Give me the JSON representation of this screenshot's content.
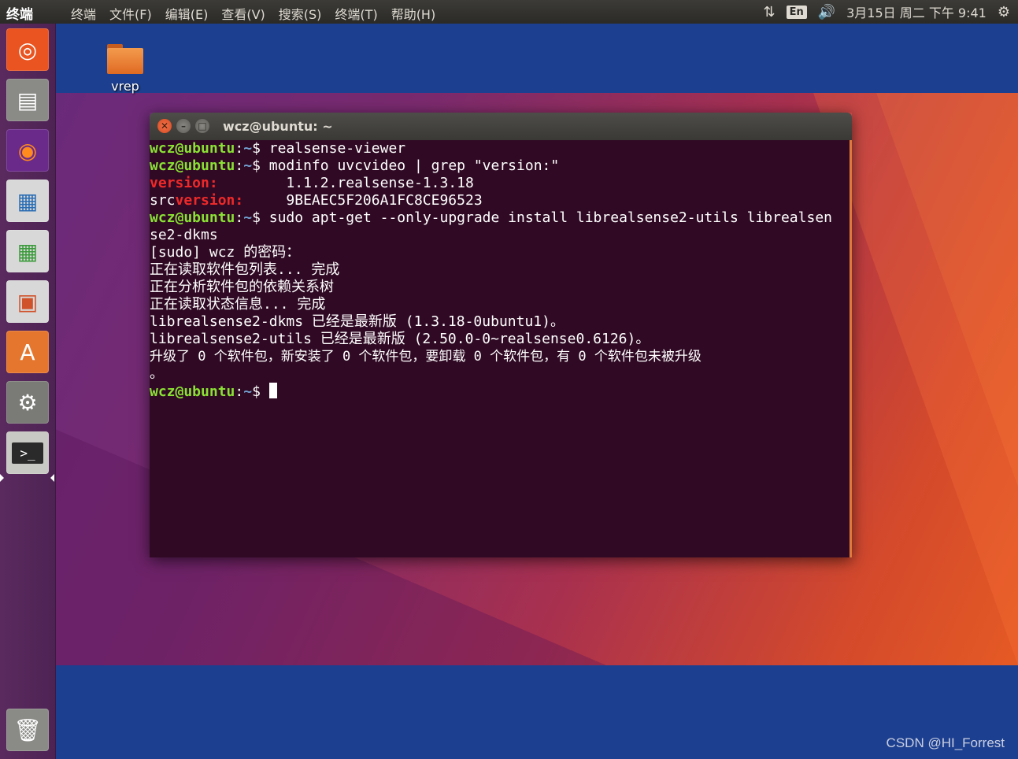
{
  "top_panel": {
    "app_title": "终端",
    "menu": [
      "终端",
      "文件(F)",
      "编辑(E)",
      "查看(V)",
      "搜索(S)",
      "终端(T)",
      "帮助(H)"
    ],
    "keyboard_lang": "En",
    "datetime": "3月15日 周二 下午 9:41"
  },
  "launcher": {
    "items": [
      {
        "name": "ubuntu-dash-icon",
        "glyph": "◎",
        "bg": "#e95420"
      },
      {
        "name": "files-icon",
        "glyph": "▤",
        "bg": "#7a7a7a"
      },
      {
        "name": "firefox-icon",
        "glyph": "◉",
        "bg": "#e66000"
      },
      {
        "name": "libreoffice-writer-icon",
        "glyph": "▦",
        "bg": "#2a6db3"
      },
      {
        "name": "libreoffice-calc-icon",
        "glyph": "▦",
        "bg": "#3c9a3c"
      },
      {
        "name": "libreoffice-impress-icon",
        "glyph": "▣",
        "bg": "#d0522a"
      },
      {
        "name": "software-center-icon",
        "glyph": "A",
        "bg": "#e5762e"
      },
      {
        "name": "system-settings-icon",
        "glyph": "⚙",
        "bg": "#6a6a6a"
      },
      {
        "name": "terminal-icon",
        "glyph": ">_",
        "bg": "#3a3a3a"
      },
      {
        "name": "trash-icon",
        "glyph": "🗑",
        "bg": "#8a8a8a"
      }
    ]
  },
  "desktop": {
    "folder_label": "vrep"
  },
  "terminal": {
    "title": "wcz@ubuntu: ~",
    "user": "wcz@ubuntu",
    "path": "~",
    "lines": {
      "cmd1": "realsense-viewer",
      "cmd2": "modinfo uvcvideo | grep \"version:\"",
      "version_key": "version:",
      "version_val": "        1.1.2.realsense-1.3.18",
      "srcversion_prefix": "src",
      "srcversion_key": "version:",
      "srcversion_val": "     9BEAEC5F206A1FC8CE96523",
      "cmd3": "sudo apt-get --only-upgrade install librealsense2-utils librealsen",
      "cmd3_wrap": "se2-dkms",
      "out1": "[sudo] wcz 的密码：",
      "out2": "正在读取软件包列表... 完成",
      "out3": "正在分析软件包的依赖关系树",
      "out4": "正在读取状态信息... 完成",
      "out5": "librealsense2-dkms 已经是最新版 (1.3.18-0ubuntu1)。",
      "out6": "librealsense2-utils 已经是最新版 (2.50.0-0~realsense0.6126)。",
      "out7": "升级了 0 个软件包，新安装了 0 个软件包，要卸载 0 个软件包，有 0 个软件包未被升级",
      "out7_wrap": "。"
    }
  },
  "watermark": "CSDN @HI_Forrest"
}
